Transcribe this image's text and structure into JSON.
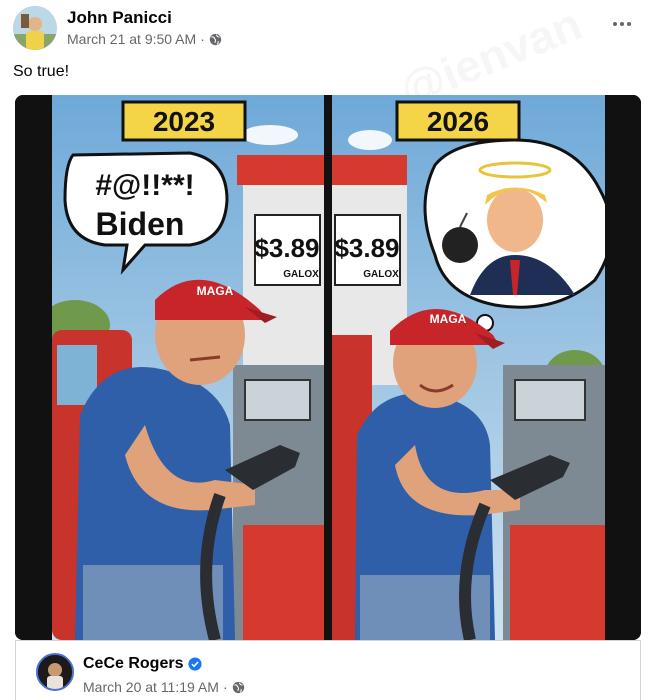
{
  "post": {
    "author": "John Panicci",
    "timestamp": "March 21 at 9:50 AM",
    "separator": "·",
    "caption": "So true!",
    "privacy_icon": "globe-icon",
    "menu_icon": "more-icon"
  },
  "image": {
    "left_panel": {
      "year": "2023",
      "speech_line1": "#@!!**!",
      "speech_line2": "Biden",
      "price": "$3.89",
      "unit": "GALOX",
      "cap_text": "MAGA"
    },
    "right_panel": {
      "year": "2026",
      "price": "$3.89",
      "unit": "GALOX",
      "cap_text": "MAGA"
    },
    "watermark": "@ienvan"
  },
  "shared_post": {
    "author": "CeCe Rogers",
    "timestamp": "March 20 at 11:19 AM",
    "separator": "·",
    "verified_icon": "verified-badge-icon",
    "privacy_icon": "globe-icon"
  },
  "colors": {
    "text_primary": "#050505",
    "text_secondary": "#65676b",
    "verified": "#1877f2",
    "sign_yellow": "#f5d548",
    "pump_red": "#d63a2f",
    "shirt_blue": "#2f5fa8",
    "cap_red": "#c8252b"
  }
}
